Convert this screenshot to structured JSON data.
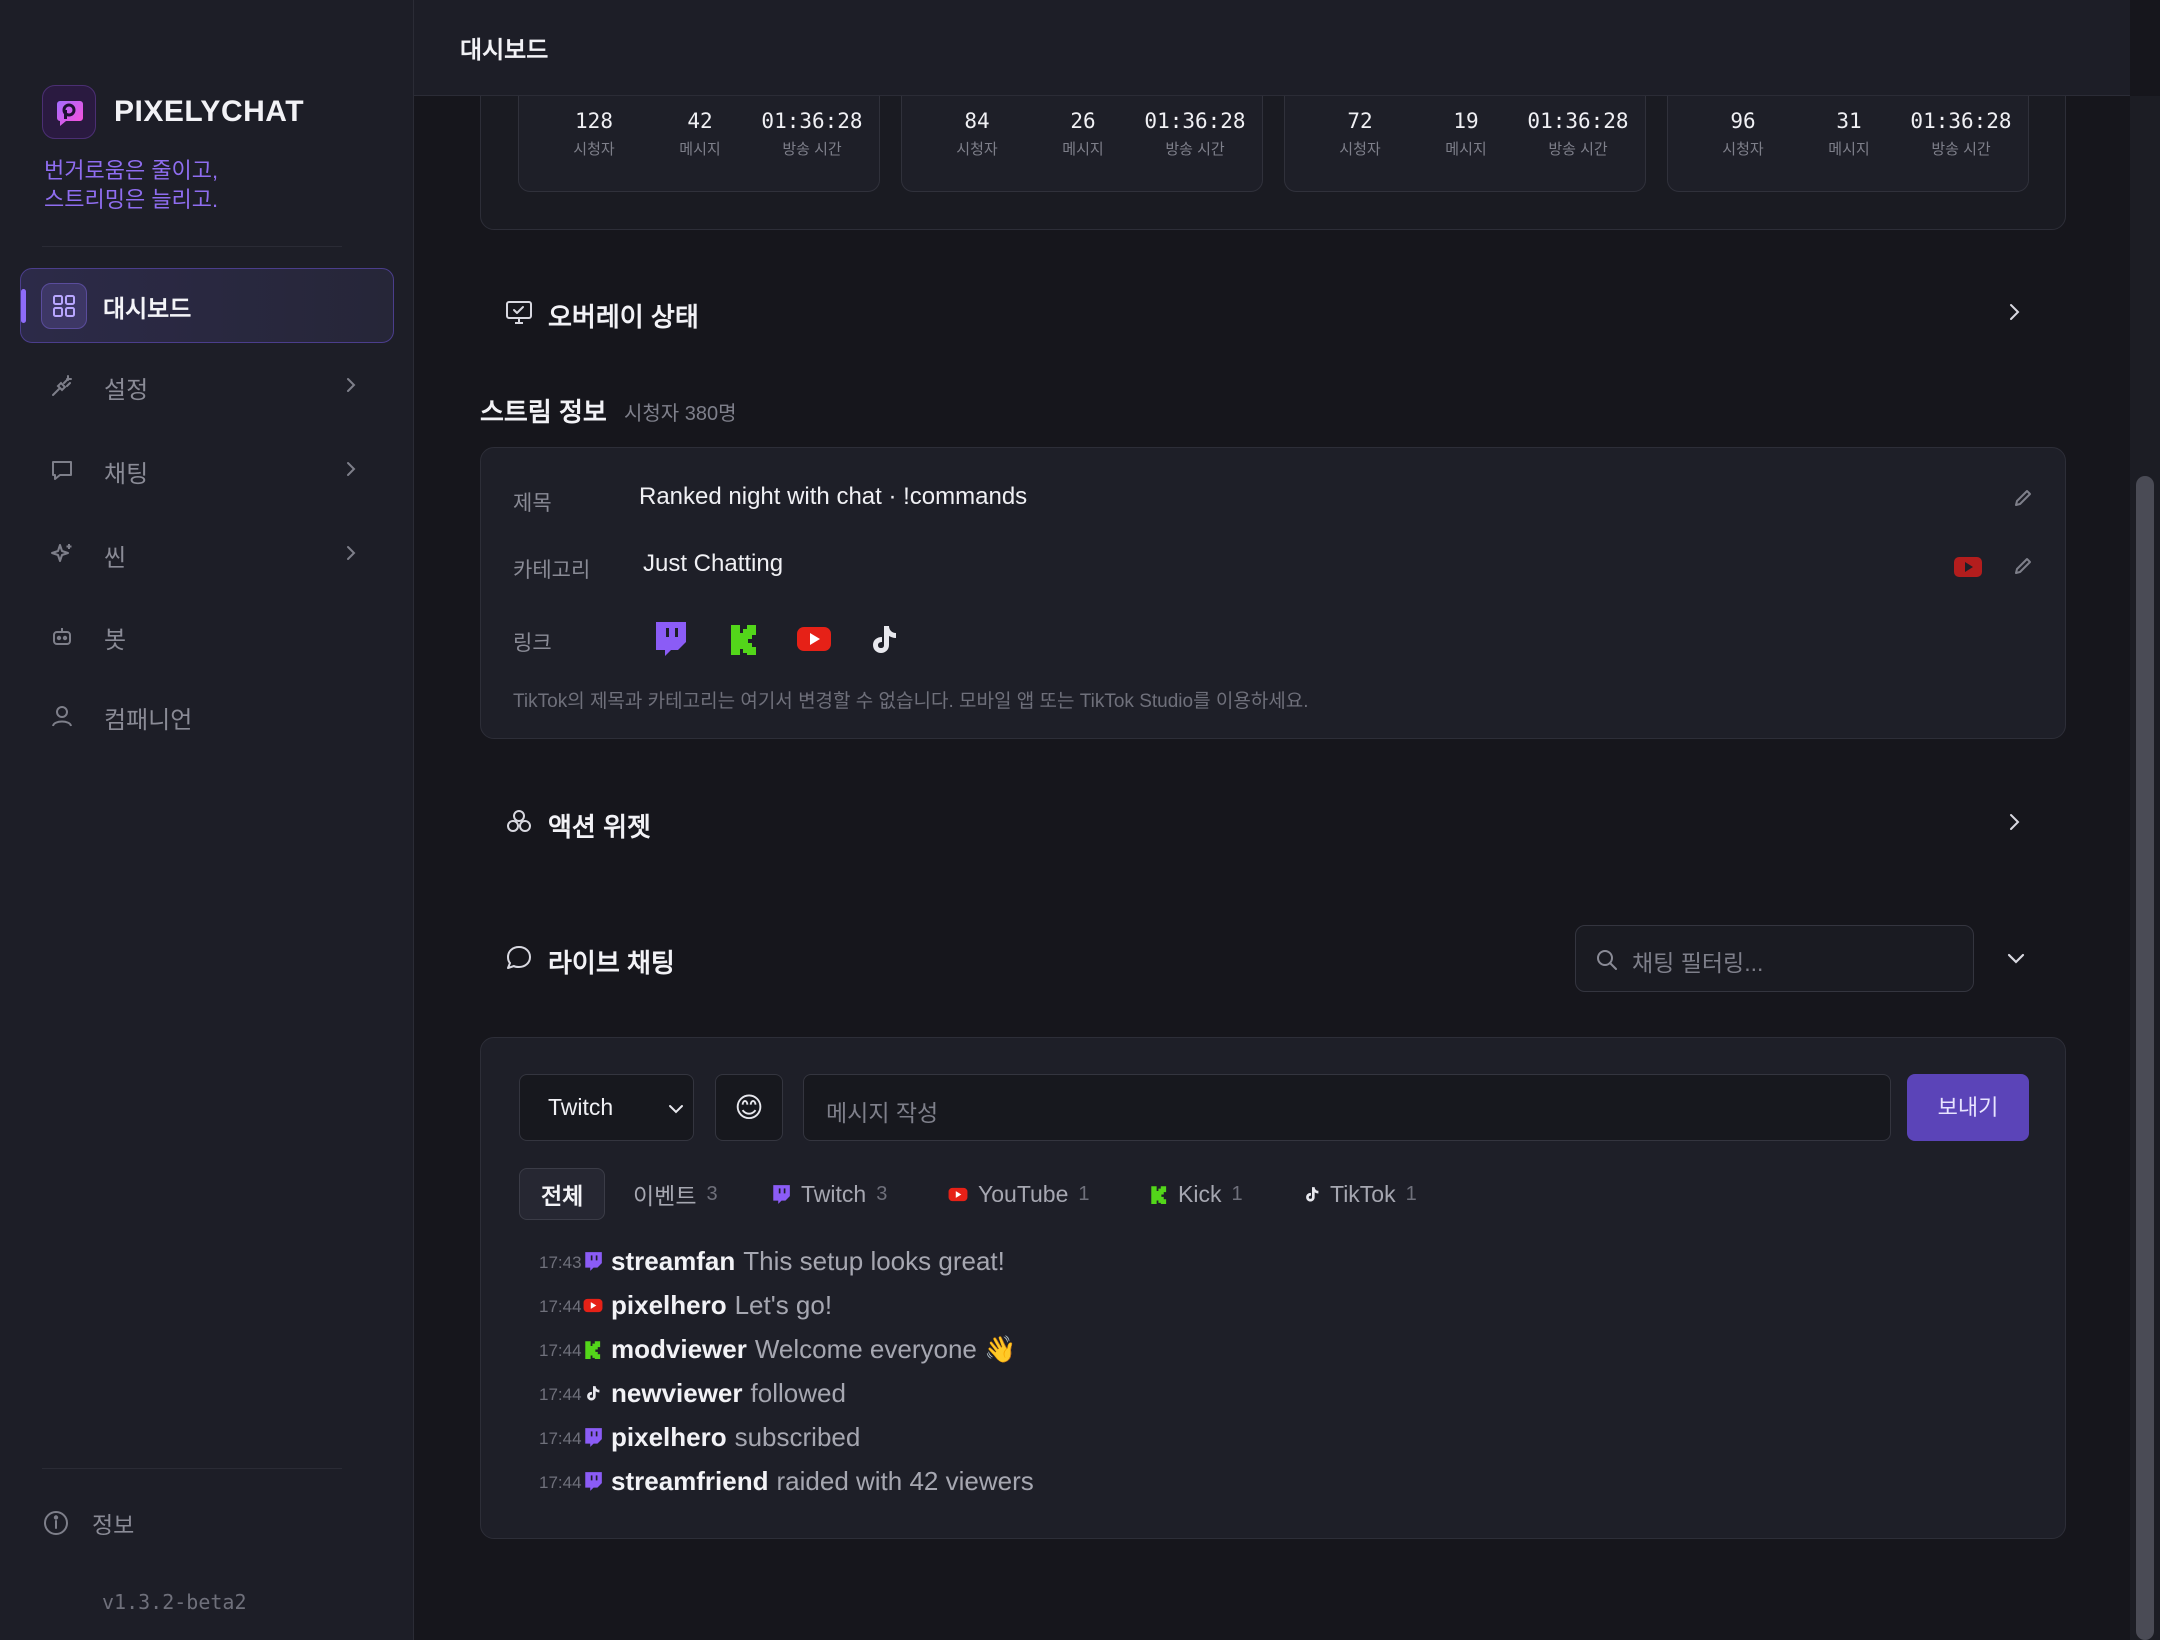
{
  "app": {
    "name": "PIXELYCHAT",
    "tagline_line1": "번거로움은 줄이고,",
    "tagline_line2": "스트리밍은 늘리고.",
    "version": "v1.3.2-beta2"
  },
  "sidebar": {
    "items": [
      {
        "label": "대시보드",
        "icon": "grid-icon",
        "active": true
      },
      {
        "label": "설정",
        "icon": "plug-icon",
        "has_submenu": true
      },
      {
        "label": "채팅",
        "icon": "chat-icon",
        "has_submenu": true
      },
      {
        "label": "씬",
        "icon": "sparkle-icon",
        "has_submenu": true
      },
      {
        "label": "봇",
        "icon": "bot-icon"
      },
      {
        "label": "컴패니언",
        "icon": "user-icon"
      }
    ],
    "footer_label": "정보"
  },
  "header": {
    "title": "대시보드"
  },
  "stats": {
    "cards": [
      {
        "viewers": "128",
        "messages": "42",
        "uptime": "01:36:28"
      },
      {
        "viewers": "84",
        "messages": "26",
        "uptime": "01:36:28"
      },
      {
        "viewers": "72",
        "messages": "19",
        "uptime": "01:36:28"
      },
      {
        "viewers": "96",
        "messages": "31",
        "uptime": "01:36:28"
      }
    ],
    "labels": {
      "viewers": "시청자",
      "messages": "메시지",
      "uptime": "방송 시간"
    }
  },
  "overlay": {
    "title": "오버레이 상태"
  },
  "stream_info": {
    "title": "스트림 정보",
    "viewer_count": "시청자 380명",
    "title_label": "제목",
    "title_value": "Ranked night with chat · !commands",
    "category_label": "카테고리",
    "category_value": "Just Chatting",
    "links_label": "링크",
    "note": "TikTok의 제목과 카테고리는 여기서 변경할 수 없습니다. 모바일 앱 또는 TikTok Studio를 이용하세요."
  },
  "actions": {
    "title": "액션 위젯"
  },
  "live_chat": {
    "title": "라이브 채팅",
    "filter_placeholder": "채팅 필터링...",
    "platform_select": "Twitch",
    "emoji": "😊",
    "message_placeholder": "메시지 작성",
    "send_label": "보내기",
    "tabs": [
      {
        "label": "전체",
        "count": ""
      },
      {
        "label": "이벤트",
        "count": "3"
      },
      {
        "label": "Twitch",
        "count": "3"
      },
      {
        "label": "YouTube",
        "count": "1"
      },
      {
        "label": "Kick",
        "count": "1"
      },
      {
        "label": "TikTok",
        "count": "1"
      }
    ],
    "messages": [
      {
        "time": "17:43",
        "platform": "twitch",
        "user": "streamfan",
        "text": "This setup looks great!"
      },
      {
        "time": "17:44",
        "platform": "youtube",
        "user": "pixelhero",
        "text": "Let's go!"
      },
      {
        "time": "17:44",
        "platform": "kick",
        "user": "modviewer",
        "text": "Welcome everyone 👋"
      },
      {
        "time": "17:44",
        "platform": "tiktok",
        "user": "newviewer",
        "text": "followed"
      },
      {
        "time": "17:44",
        "platform": "twitch",
        "user": "pixelhero",
        "text": "subscribed"
      },
      {
        "time": "17:44",
        "platform": "twitch",
        "user": "streamfriend",
        "text": "raided with 42 viewers"
      }
    ]
  },
  "colors": {
    "accent": "#8e6cf8",
    "twitch": "#9146ff",
    "youtube": "#e62117",
    "kick": "#53fc18",
    "tiktok": "#ffffff"
  }
}
